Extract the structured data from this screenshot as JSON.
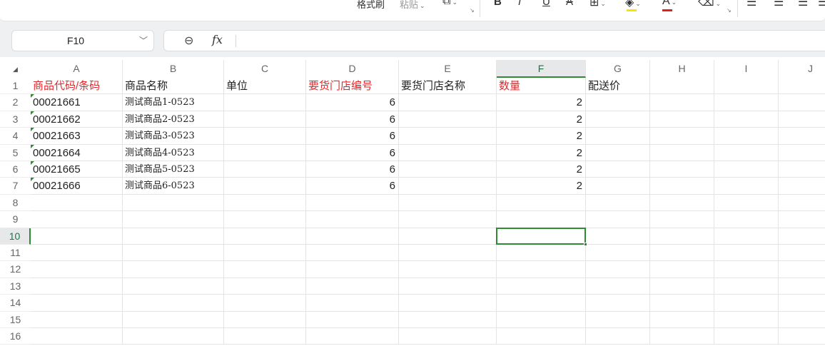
{
  "ribbon": {
    "format_painter": "格式刷",
    "paste": "粘贴",
    "icons": [
      "paste-special-icon",
      "bold-icon",
      "italic-icon",
      "underline-icon",
      "strikethrough-icon",
      "border-icon",
      "fill-color-icon",
      "font-color-icon",
      "clear-icon",
      "align-left-icon",
      "align-center-icon",
      "align-right-icon"
    ],
    "bold": "B",
    "italic": "I",
    "underline": "U",
    "strike": "A",
    "fill_color": "#f5e600",
    "font_color": "#e0201e"
  },
  "formula_bar": {
    "name_box": "F10",
    "fx": "fx",
    "formula": ""
  },
  "columns": [
    "A",
    "B",
    "C",
    "D",
    "E",
    "F",
    "G",
    "H",
    "I",
    "J"
  ],
  "rows": [
    "1",
    "2",
    "3",
    "4",
    "5",
    "6",
    "7",
    "8",
    "9",
    "10",
    "11",
    "12",
    "13",
    "14",
    "15",
    "16"
  ],
  "active_cell": {
    "column": "F",
    "row": "10"
  },
  "sheet": {
    "header": {
      "A": "商品代码/条码",
      "B": "商品名称",
      "C": "单位",
      "D": "要货门店编号",
      "E": "要货门店名称",
      "F": "数量",
      "G": "配送价"
    },
    "data_rows": [
      {
        "A": "00021661",
        "B": "测试商品1-0523",
        "D": "6",
        "F": "2"
      },
      {
        "A": "00021662",
        "B": "测试商品2-0523",
        "D": "6",
        "F": "2"
      },
      {
        "A": "00021663",
        "B": "测试商品3-0523",
        "D": "6",
        "F": "2"
      },
      {
        "A": "00021664",
        "B": "测试商品4-0523",
        "D": "6",
        "F": "2"
      },
      {
        "A": "00021665",
        "B": "测试商品5-0523",
        "D": "6",
        "F": "2"
      },
      {
        "A": "00021666",
        "B": "测试商品6-0523",
        "D": "6",
        "F": "2"
      }
    ]
  },
  "colors": {
    "required_header": "#e8262a",
    "selection": "#2e8b34"
  }
}
